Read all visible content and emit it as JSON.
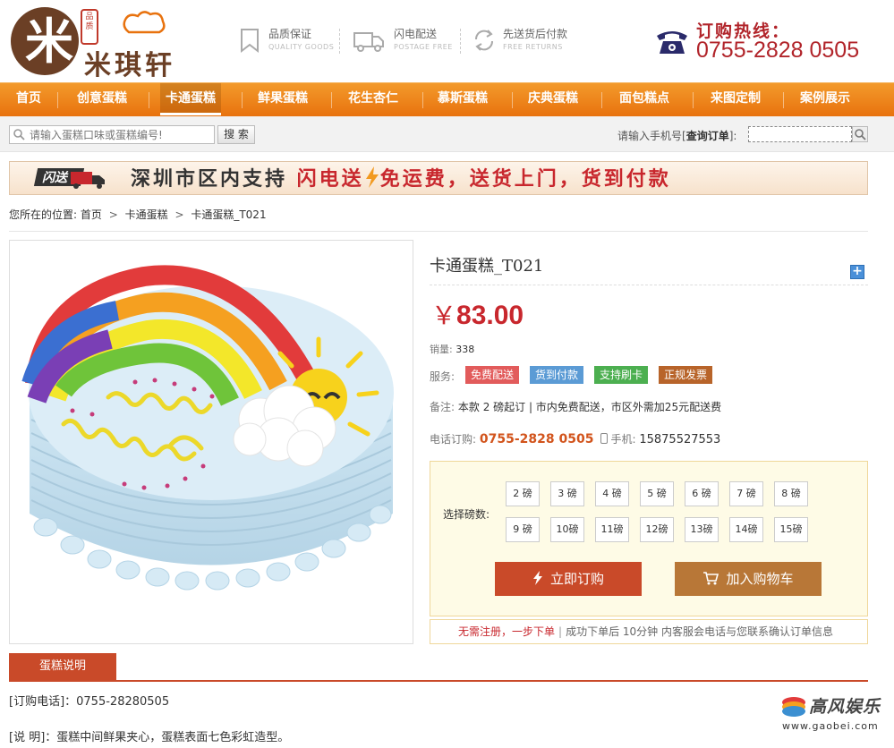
{
  "header": {
    "logo_seal": "品质",
    "logo_text": "米琪轩",
    "features": [
      {
        "title": "品质保证",
        "sub": "QUALITY GOODS",
        "icon": "bookmark-icon"
      },
      {
        "title": "闪电配送",
        "sub": "POSTAGE FREE",
        "icon": "truck-icon"
      },
      {
        "title": "先送货后付款",
        "sub": "FREE RETURNS",
        "icon": "return-icon"
      }
    ],
    "hotline_label": "订购热线：",
    "hotline_number": "0755-2828 0505"
  },
  "nav": {
    "items": [
      "首页",
      "创意蛋糕",
      "卡通蛋糕",
      "鲜果蛋糕",
      "花生杏仁",
      "慕斯蛋糕",
      "庆典蛋糕",
      "面包糕点",
      "来图定制",
      "案例展示"
    ],
    "active_index": 2
  },
  "search": {
    "placeholder": "请输入蛋糕口味或蛋糕编号!",
    "button": "搜 索",
    "order_label_prefix": "请输入手机号[",
    "order_label_link": "查询订单",
    "order_label_suffix": "]:"
  },
  "banner": {
    "logo_text": "闪送",
    "text_part1": "深圳市区内支持 ",
    "text_part2": "闪电送",
    "text_part3": "免运费，送货上门，货到付款"
  },
  "breadcrumb": {
    "prefix": "您所在的位置:",
    "items": [
      "首页",
      "卡通蛋糕",
      "卡通蛋糕_T021"
    ]
  },
  "product": {
    "title": "卡通蛋糕_T021",
    "currency": "￥",
    "price": "83.00",
    "sales_label": "销量:",
    "sales_value": "338",
    "service_label": "服务:",
    "service_tags": [
      {
        "label": "免费配送",
        "color": "#e25b5b"
      },
      {
        "label": "货到付款",
        "color": "#5b9bd5"
      },
      {
        "label": "支持刷卡",
        "color": "#4caf50"
      },
      {
        "label": "正规发票",
        "color": "#b8642a"
      }
    ],
    "note_label": "备注:",
    "note_value": "本款 2 磅起订 | 市内免费配送，市区外需加25元配送费",
    "phone_label": "电话订购:",
    "phone_value": "0755-2828 0505",
    "mobile_label": "手机:",
    "mobile_value": "15875527553",
    "option_label": "选择磅数:",
    "options": [
      "2 磅",
      "3 磅",
      "4 磅",
      "5 磅",
      "6 磅",
      "7 磅",
      "8 磅",
      "9 磅",
      "10磅",
      "11磅",
      "12磅",
      "13磅",
      "14磅",
      "15磅"
    ],
    "buy_button": "立即订购",
    "cart_button": "加入购物车",
    "notice_red": "无需注册，一步下单",
    "notice_text": "成功下单后 10分钟 内客服会电话与您联系确认订单信息"
  },
  "description": {
    "tab": "蛋糕说明",
    "line1": "[订购电话]：0755-28280505",
    "line2": "[说 明]：蛋糕中间鲜果夹心，蛋糕表面七色彩虹造型。"
  },
  "watermark": {
    "text": "高风娱乐",
    "url": "www.gaobei.com"
  }
}
